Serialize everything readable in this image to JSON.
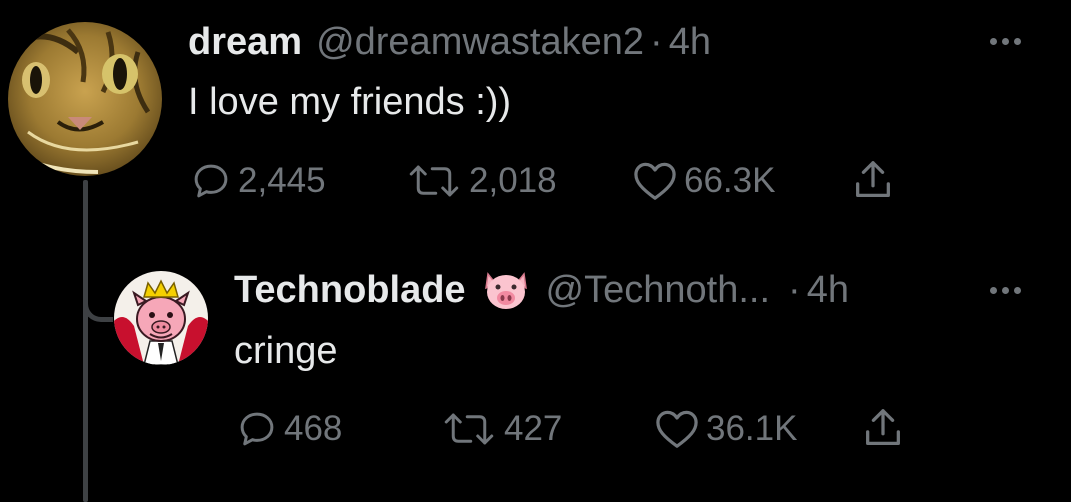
{
  "colors": {
    "background": "#000000",
    "primary_text": "#e7e9ea",
    "secondary_text": "#71767b",
    "thread_line": "#3e4144"
  },
  "tweets": [
    {
      "display_name": "dream",
      "handle": "@dreamwastaken2",
      "separator": "·",
      "time": "4h",
      "text": "I love my friends :))",
      "replies": "2,445",
      "retweets": "2,018",
      "likes": "66.3K",
      "avatar_icon": "cat-avatar"
    },
    {
      "display_name": "Technoblade",
      "name_emoji": "pig-face-emoji",
      "handle": "@Technoth...",
      "separator": "·",
      "time": "4h",
      "text": "cringe",
      "replies": "468",
      "retweets": "427",
      "likes": "36.1K",
      "avatar_icon": "crowned-pig-avatar"
    }
  ]
}
